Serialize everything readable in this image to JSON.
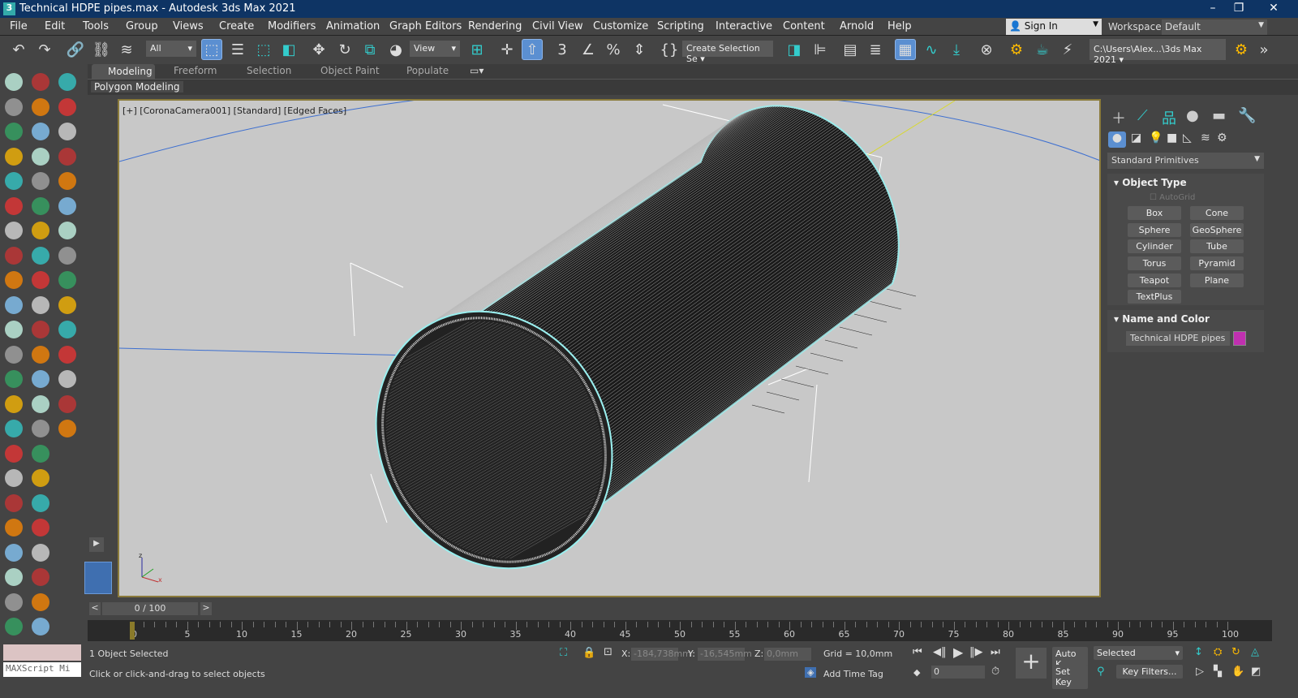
{
  "window": {
    "title": "Technical HDPE pipes.max - Autodesk 3ds Max 2021",
    "logo": "3",
    "minimize": "–",
    "restore": "❐",
    "close": "✕"
  },
  "menu": [
    "File",
    "Edit",
    "Tools",
    "Group",
    "Views",
    "Create",
    "Modifiers",
    "Animation",
    "Graph Editors",
    "Rendering",
    "Civil View",
    "Customize",
    "Scripting",
    "Interactive",
    "Content",
    "Arnold",
    "Help"
  ],
  "account": {
    "sign_in": "Sign In",
    "workspaces_label": "Workspaces:",
    "workspace": "Default"
  },
  "toolbar": {
    "selection_filter": "All",
    "ref_coord": "View",
    "named_selection": "Create Selection Se",
    "project_path": "C:\\Users\\Alex...\\3ds Max 2021"
  },
  "ribbon": {
    "tabs": [
      "Modeling",
      "Freeform",
      "Selection",
      "Object Paint",
      "Populate"
    ],
    "panel": "Polygon Modeling"
  },
  "viewport": {
    "label": "[+] [CoronaCamera001] [Standard] [Edged Faces]"
  },
  "command_panel": {
    "category": "Standard Primitives",
    "object_type_title": "Object Type",
    "autogrid": "AutoGrid",
    "buttons": [
      "Box",
      "Cone",
      "Sphere",
      "GeoSphere",
      "Cylinder",
      "Tube",
      "Torus",
      "Pyramid",
      "Teapot",
      "Plane",
      "TextPlus"
    ],
    "name_color_title": "Name and Color",
    "object_name": "Technical HDPE pipes",
    "object_color": "#c030b0"
  },
  "timeline": {
    "position": "0 / 100",
    "prev": "<",
    "next": ">",
    "ticks": [
      0,
      5,
      10,
      15,
      20,
      25,
      30,
      35,
      40,
      45,
      50,
      55,
      60,
      65,
      70,
      75,
      80,
      85,
      90,
      95,
      100
    ],
    "current_frame": 0
  },
  "status": {
    "selected": "1 Object Selected",
    "prompt": "Click or click-and-drag to select objects",
    "maxscript": "MAXScript Mi",
    "x_label": "X:",
    "x": "-184,738mm",
    "y_label": "Y:",
    "y": "-16,545mm",
    "z_label": "Z:",
    "z": "0,0mm",
    "grid": "Grid = 10,0mm",
    "add_time_tag": "Add Time Tag",
    "auto_key": "Auto K...",
    "set_key": "Set Key",
    "key_mode": "Selected",
    "key_filters": "Key Filters...",
    "frame": "0"
  }
}
